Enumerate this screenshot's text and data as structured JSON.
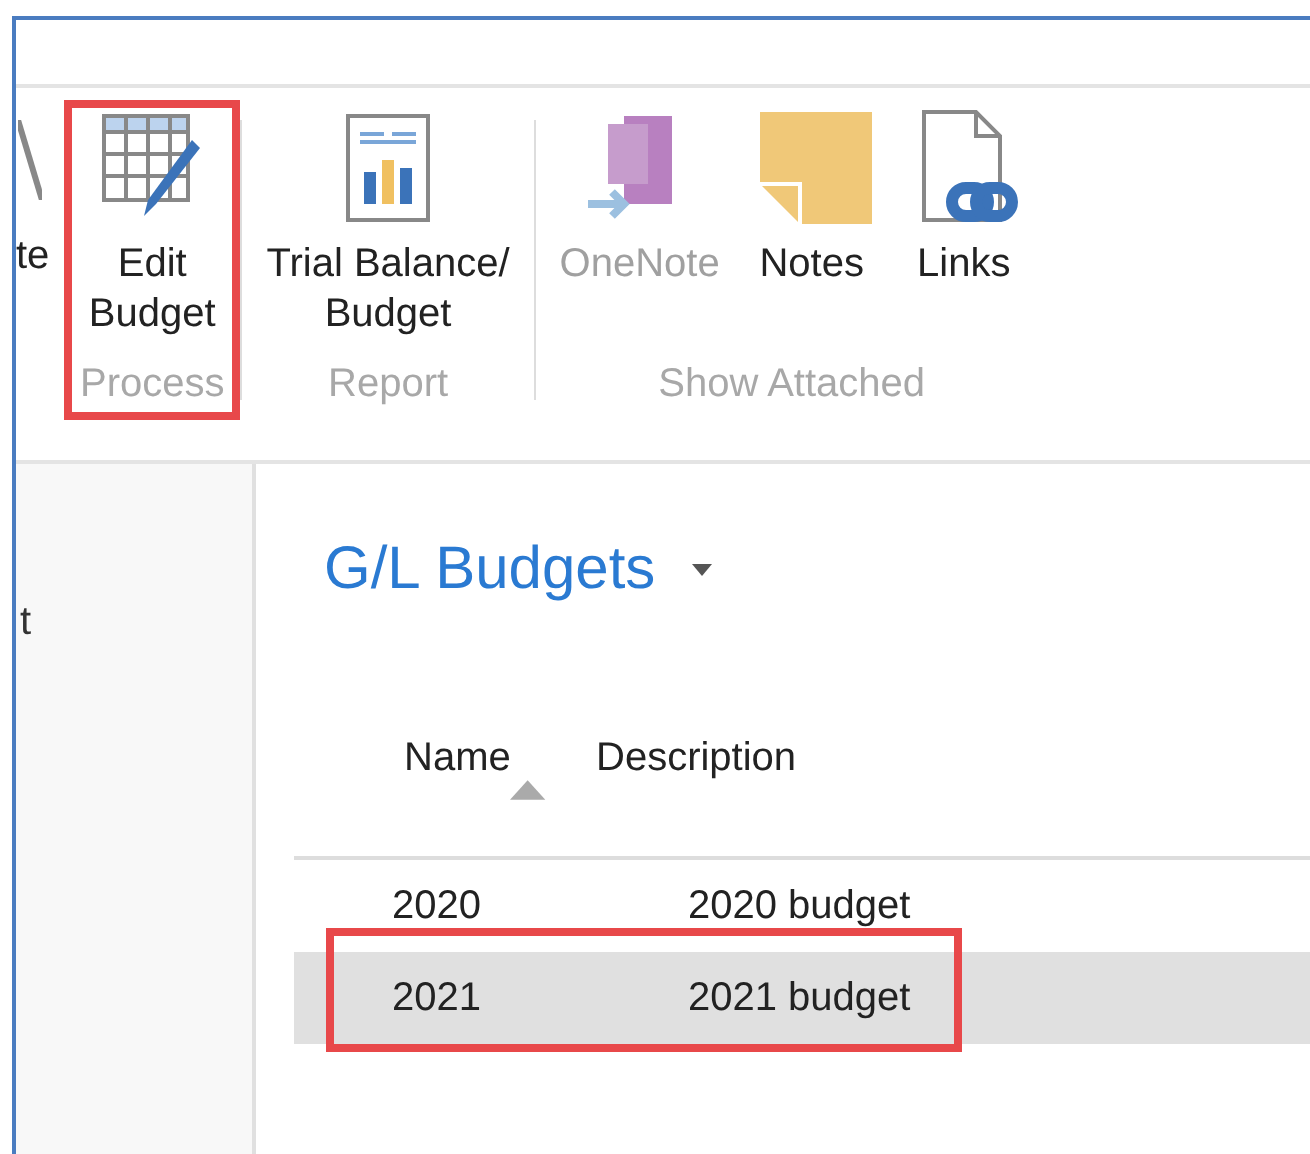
{
  "ribbon": {
    "groups": [
      {
        "buttons": [
          {
            "label": "te",
            "kind": "cross",
            "disabled": false
          }
        ]
      },
      {
        "label": "Process",
        "highlighted": true,
        "buttons": [
          {
            "label": "Edit\nBudget",
            "kind": "grid-pencil",
            "disabled": false
          }
        ]
      },
      {
        "label": "Report",
        "highlighted": false,
        "buttons": [
          {
            "label": "Trial Balance/\nBudget",
            "kind": "report",
            "disabled": false
          }
        ]
      },
      {
        "label": "Show Attached",
        "highlighted": false,
        "buttons": [
          {
            "label": "OneNote",
            "kind": "onenote",
            "disabled": true
          },
          {
            "label": "Notes",
            "kind": "note",
            "disabled": false
          },
          {
            "label": "Links",
            "kind": "link",
            "disabled": false
          }
        ]
      }
    ]
  },
  "sidebar": {
    "items": [
      {
        "label": "t"
      }
    ]
  },
  "page": {
    "title": "G/L Budgets",
    "table": {
      "columns": [
        {
          "label": "Name",
          "sorted": true
        },
        {
          "label": "Description",
          "sorted": false
        }
      ],
      "rows": [
        {
          "cells": [
            "2020",
            "2020 budget"
          ],
          "selected": false,
          "highlighted": false
        },
        {
          "cells": [
            "2021",
            "2021 budget"
          ],
          "selected": true,
          "highlighted": true
        }
      ]
    }
  }
}
